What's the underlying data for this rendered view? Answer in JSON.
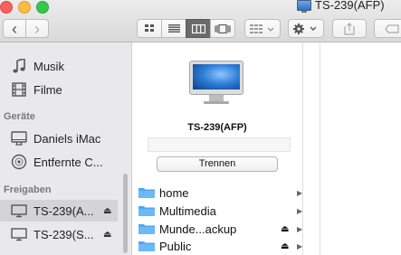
{
  "window": {
    "title": "TS-239(AFP)"
  },
  "toolbar": {
    "back_glyph": "‹",
    "forward_glyph": "›",
    "views": [
      "icon-view",
      "list-view",
      "column-view",
      "cover-flow-view"
    ],
    "active_view": "column-view",
    "arrange_icon": "grid-arrange-icon",
    "action_icon": "gear-icon",
    "share_icon": "share-icon",
    "tag_icon": "tag-icon"
  },
  "sidebar": {
    "favorites": [
      {
        "label": "Musik",
        "icon": "music-note-icon"
      },
      {
        "label": "Filme",
        "icon": "film-icon"
      }
    ],
    "devices_heading": "Geräte",
    "devices": [
      {
        "label": "Daniels iMac",
        "icon": "imac-icon"
      },
      {
        "label": "Entfernte C...",
        "icon": "optical-disc-icon"
      }
    ],
    "shared_heading": "Freigaben",
    "shared": [
      {
        "label": "TS-239(A...",
        "icon": "server-display-icon",
        "eject": "⏏"
      },
      {
        "label": "TS-239(S...",
        "icon": "server-display-icon",
        "eject": "⏏"
      }
    ]
  },
  "server": {
    "name": "TS-239(AFP)",
    "disconnect_label": "Trennen",
    "folders": [
      {
        "label": "home",
        "eject": ""
      },
      {
        "label": "Multimedia",
        "eject": ""
      },
      {
        "label": "Munde...ackup",
        "eject": "⏏"
      },
      {
        "label": "Public",
        "eject": "⏏"
      }
    ]
  },
  "colors": {
    "folder_blue": "#4ea7f0",
    "sidebar_bg": "#e9e9eb",
    "selected_bg": "#d4d4d6"
  }
}
